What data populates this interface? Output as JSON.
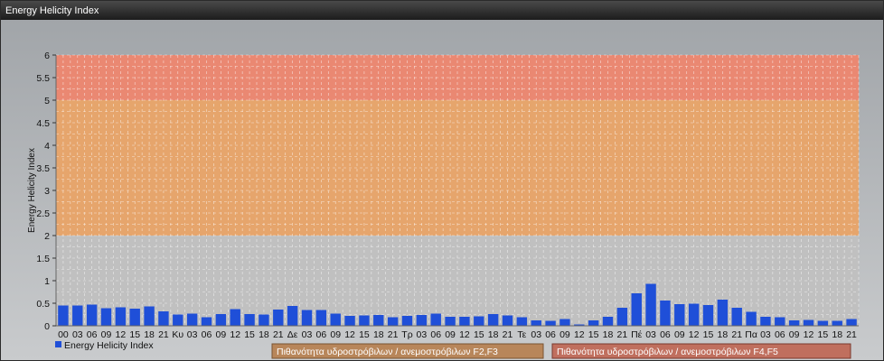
{
  "window": {
    "title": "Energy Helicity Index"
  },
  "chart_data": {
    "type": "bar",
    "ylabel": "Energy Helicity Index",
    "xlabel": "",
    "ylim": [
      0,
      6
    ],
    "yticks": [
      "0",
      "0.5",
      "1",
      "1.5",
      "2",
      "2.5",
      "3",
      "3.5",
      "4",
      "4.5",
      "5",
      "5.5",
      "6"
    ],
    "grid": true,
    "categories": [
      "00",
      "03",
      "06",
      "09",
      "12",
      "15",
      "18",
      "21",
      "Κυ",
      "03",
      "06",
      "09",
      "12",
      "15",
      "18",
      "21",
      "Δε",
      "03",
      "06",
      "09",
      "12",
      "15",
      "18",
      "21",
      "Τρ",
      "03",
      "06",
      "09",
      "12",
      "15",
      "18",
      "21",
      "Τε",
      "03",
      "06",
      "09",
      "12",
      "15",
      "18",
      "21",
      "Πέ",
      "03",
      "06",
      "09",
      "12",
      "15",
      "18",
      "21",
      "Πα",
      "03",
      "06",
      "09",
      "12",
      "15",
      "18",
      "21"
    ],
    "series": [
      {
        "name": "Energy Helicity Index",
        "color": "#1f4fd8",
        "values": [
          0.45,
          0.45,
          0.47,
          0.39,
          0.41,
          0.38,
          0.43,
          0.32,
          0.25,
          0.27,
          0.19,
          0.26,
          0.37,
          0.26,
          0.25,
          0.36,
          0.44,
          0.35,
          0.35,
          0.27,
          0.22,
          0.23,
          0.24,
          0.19,
          0.22,
          0.24,
          0.27,
          0.2,
          0.2,
          0.21,
          0.26,
          0.23,
          0.19,
          0.12,
          0.11,
          0.15,
          0.03,
          0.12,
          0.2,
          0.4,
          0.72,
          0.93,
          0.56,
          0.48,
          0.49,
          0.46,
          0.58,
          0.4,
          0.31,
          0.2,
          0.19,
          0.12,
          0.13,
          0.11,
          0.11,
          0.15
        ]
      }
    ],
    "bands": [
      {
        "from": 0,
        "to": 2,
        "color": "#c0c0c0"
      },
      {
        "from": 2,
        "to": 5,
        "color": "#e6a56c",
        "label": "Πιθανότητα υδροστρόβιλων / ανεμοστρόβιλων F2,F3"
      },
      {
        "from": 5,
        "to": 6,
        "color": "#ea8872",
        "label": "Πιθανότητα υδροστρόβιλων / ανεμοστρόβιλων F4,F5"
      }
    ],
    "legend": {
      "position": "bottom-left"
    }
  }
}
